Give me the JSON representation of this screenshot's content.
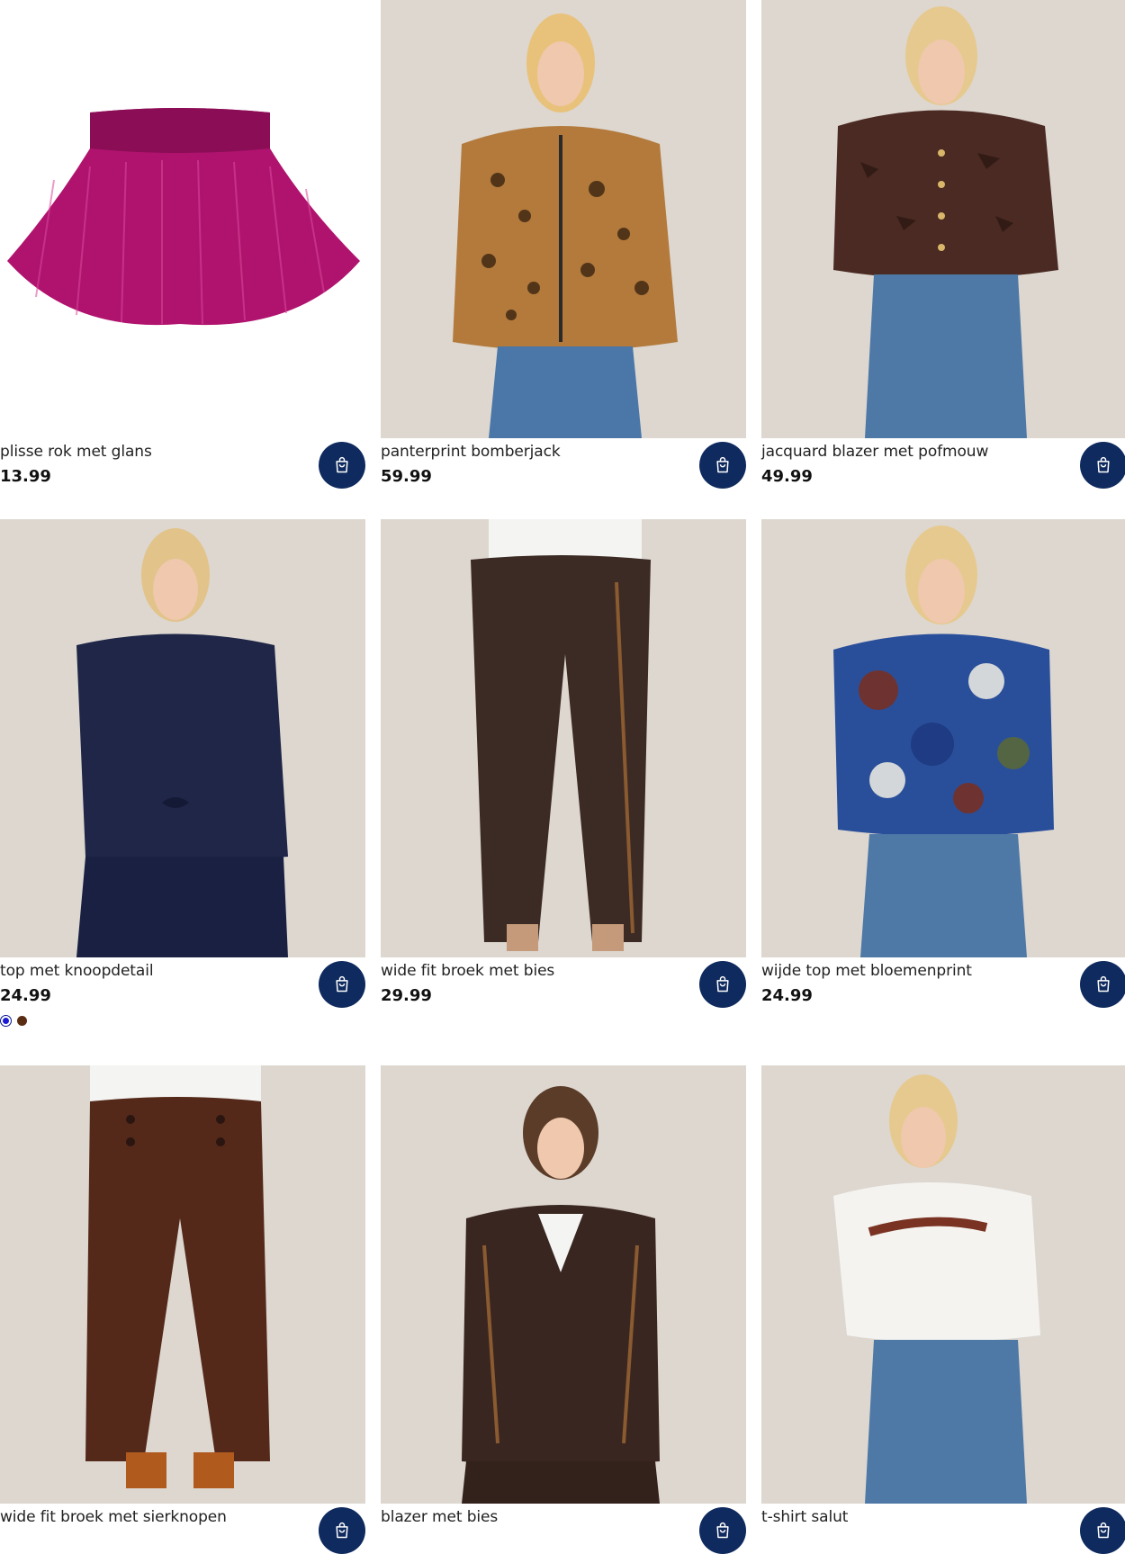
{
  "products": [
    {
      "name": "plisse rok met glans",
      "price": "13.99"
    },
    {
      "name": "panterprint bomberjack",
      "price": "59.99"
    },
    {
      "name": "jacquard blazer met pofmouw",
      "price": "49.99"
    },
    {
      "name": "top met knoopdetail",
      "price": "24.99"
    },
    {
      "name": "wide fit broek met bies",
      "price": "29.99"
    },
    {
      "name": "wijde top met bloemenprint",
      "price": "24.99"
    },
    {
      "name": "wide fit broek met sierknopen",
      "price": ""
    },
    {
      "name": "blazer met bies",
      "price": ""
    },
    {
      "name": "t-shirt salut",
      "price": ""
    }
  ],
  "swatches": [
    {
      "color": "#1a1ad6",
      "selected": true
    },
    {
      "color": "#5a2d12",
      "selected": false
    }
  ],
  "colors": {
    "cart_button": "#0f2a5e"
  },
  "icons": {
    "cart": "shopping-bag-icon"
  }
}
